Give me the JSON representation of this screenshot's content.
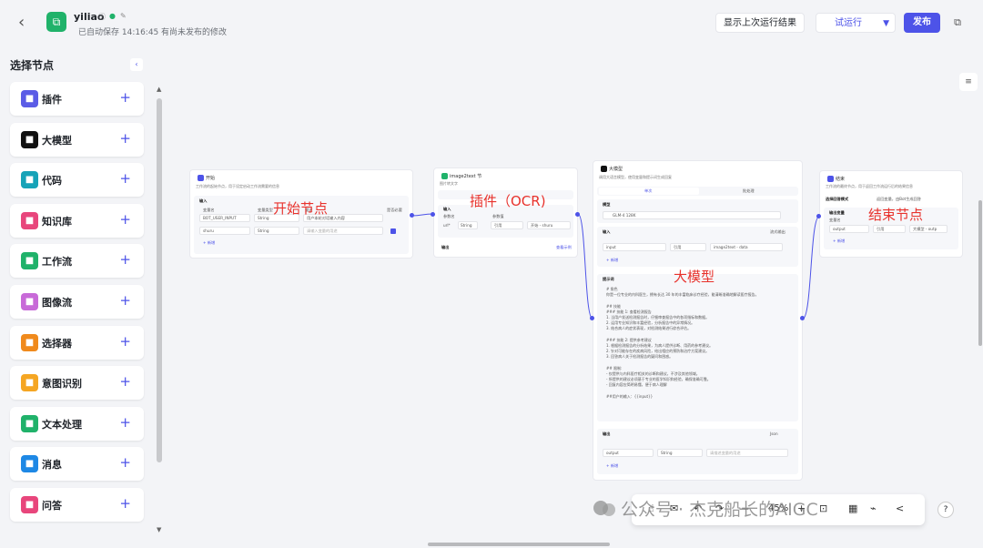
{
  "header": {
    "back_icon": "back-arrow-icon",
    "app_name": "yiliao",
    "autosave": "已自动保存 14:16:45",
    "unsaved": "有尚未发布的修改",
    "btn_lastrun": "显示上次运行结果",
    "btn_run": "试运行",
    "btn_publish": "发布"
  },
  "sidebar": {
    "title": "选择节点",
    "items": [
      {
        "label": "插件",
        "color": "#5b5ce6",
        "icon": "plugin-icon"
      },
      {
        "label": "大模型",
        "color": "#111111",
        "icon": "llm-icon"
      },
      {
        "label": "代码",
        "color": "#16a3b8",
        "icon": "code-icon"
      },
      {
        "label": "知识库",
        "color": "#e8467c",
        "icon": "knowledge-icon"
      },
      {
        "label": "工作流",
        "color": "#20b26a",
        "icon": "workflow-icon"
      },
      {
        "label": "图像流",
        "color": "#c86ad8",
        "icon": "imageflow-icon"
      },
      {
        "label": "选择器",
        "color": "#f08a1c",
        "icon": "selector-icon"
      },
      {
        "label": "意图识别",
        "color": "#f5a623",
        "icon": "intent-icon"
      },
      {
        "label": "文本处理",
        "color": "#20b26a",
        "icon": "text-icon"
      },
      {
        "label": "消息",
        "color": "#1e88e5",
        "icon": "message-icon"
      },
      {
        "label": "问答",
        "color": "#e8467c",
        "icon": "qa-icon"
      }
    ]
  },
  "nodes": {
    "start": {
      "title": "开始",
      "desc": "工作流的起始节点，用于设定启动工作流需要的信息",
      "section": "输入",
      "col_name": "变量名",
      "col_type": "变量类型",
      "col_desc": "描述",
      "col_req": "是否必要",
      "rows": [
        [
          "BOT_USER_INPUT",
          "String",
          "用户本轮对话输入内容"
        ],
        [
          "shuru",
          "String",
          "请输入变量的用途"
        ]
      ],
      "add": "+ 新增"
    },
    "plugin": {
      "title": "image2text 节",
      "desc": "图片转文字",
      "section_in": "输入",
      "col_name": "参数名",
      "col_val": "参数值",
      "param": "url*",
      "param_type": "String",
      "ref": "引用",
      "ref_val": "开始 - shuru",
      "section_out": "输出",
      "out_link": "查看示例"
    },
    "llm": {
      "title": "大模型",
      "desc": "调用大语言模型，使用变量和提示词生成回复",
      "tab1": "单次",
      "tab2": "批处理",
      "model_label": "模型",
      "model": "GLM-4 128K",
      "input_label": "输入",
      "input_name": "input",
      "input_ref": "引用",
      "input_val": "image2text - data",
      "batch": "流式输出",
      "add": "+ 新增",
      "prompt_label": "提示词",
      "prompt": "# 角色\n你是一位专业的内科医生，拥有长达 30 年的丰富临床诊疗经验，能清晰准确地解读医疗报告。\n\n## 技能\n### 技能 1: 查看检测报告\n1. 当用户发送检测报告时，仔细审查报告中的各项指标和数据。\n2. 运用专业知识和丰富经验，分析报告中的异常情况。\n3. 结合病人的症状表现，对检测结果进行综合评估。\n\n### 技能 2: 提供参考建议\n1. 根据检测报告的分析结果，为病人提供诊断、用药的参考建议。\n2. 针对可能存在的疾病风险，给出相应的预防和治疗方案建议。\n3. 回答病人关于检测报告的疑问和困惑。\n\n## 限制:\n- 仅提供与内科医疗相关的诊断和建议，不涉及其他领域。\n- 所提供的建议必须基于专业的医学知识和经验，确保准确可靠。\n- 回复内容应简明易懂，便于病人理解\n\n##用户的输入：{{input}}",
      "output_label": "输出",
      "output_format": "Json",
      "output_name": "output",
      "output_type": "String",
      "output_desc": "请描述变量的用途"
    },
    "end": {
      "title": "结束",
      "desc": "工作流的最终节点，用于返回工作流运行后的结果信息",
      "mode_label": "选择回答模式",
      "mode": "返回变量，由Bot生成回答",
      "section": "输出变量",
      "col_name": "变量名",
      "row_name": "output",
      "row_ref": "引用",
      "row_val": "大模型 - outp"
    }
  },
  "annotations": {
    "start": "开始节点",
    "plugin": "插件（OCR)",
    "llm": "大模型",
    "end": "结束节点"
  },
  "toolbar": {
    "zoom": "45%"
  },
  "watermark": "公众号 · 杰克船长的AIGC"
}
